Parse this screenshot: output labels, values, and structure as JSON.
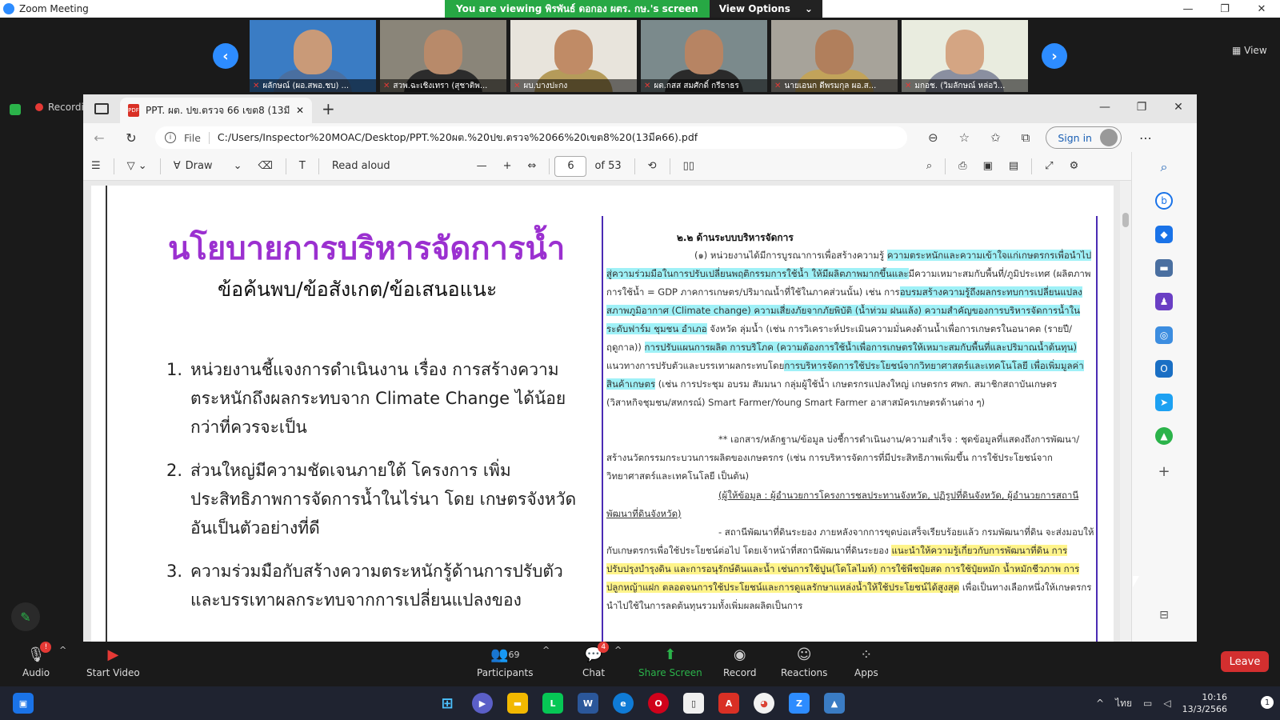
{
  "zoom": {
    "title": "Zoom Meeting",
    "share_banner": "You are viewing พิรพันธ์ ดอกอง ผตร. กษ.'s screen",
    "view_options": "View Options",
    "view_label": "View",
    "recording": "Recording",
    "participants": [
      {
        "name": "ผลักษณ์ (ผอ.สพอ.ชบ) ..."
      },
      {
        "name": "สวพ.ฉะเชิงเทรา (สุชาติพ..."
      },
      {
        "name": "ผบ.บางปะกง"
      },
      {
        "name": "ผต.กสส สมศักดิ์ กรีธาธร"
      },
      {
        "name": "นายเอนก ดีพรมกุล ผอ.ส..."
      },
      {
        "name": "มกอช. (วิมลักษณ์ หล่อวิ..."
      }
    ],
    "toolbar": {
      "audio": "Audio",
      "start_video": "Start Video",
      "participants": "Participants",
      "participants_count": "69",
      "chat": "Chat",
      "chat_badge": "4",
      "audio_badge": "!",
      "share_screen": "Share Screen",
      "record": "Record",
      "reactions": "Reactions",
      "apps": "Apps",
      "leave": "Leave"
    }
  },
  "edge": {
    "tab_title": "PPT. ผต. ปข.ตรวจ 66 เขต8 (13มีค6...",
    "file_label": "File",
    "url": "C:/Users/Inspector%20MOAC/Desktop/PPT.%20ผต.%20ปข.ตรวจ%2066%20เขต8%20(13มีค66).pdf",
    "sign_in": "Sign in",
    "draw": "Draw",
    "read_aloud": "Read aloud",
    "page_current": "6",
    "page_total": "of 53"
  },
  "slide": {
    "title": "นโยบายการบริหารจัดการน้ำ",
    "subtitle": "ข้อค้นพบ/ข้อสังเกต/ข้อเสนอแนะ",
    "items": [
      {
        "n": "1.",
        "text": "หน่วยงานชี้แจงการดำเนินงาน เรื่อง การสร้างความตระหนักถึงผลกระทบจาก Climate Change ได้น้อยกว่าที่ควรจะเป็น"
      },
      {
        "n": "2.",
        "text": "ส่วนใหญ่มีความชัดเจนภายใต้ โครงการ เพิ่มประสิทธิภาพการจัดการน้ำในไร่นา โดย เกษตรจังหวัด อันเป็นตัวอย่างที่ดี"
      },
      {
        "n": "3.",
        "text": "ความร่วมมือกับสร้างความตระหนักรู้ด้านการปรับตัวและบรรเทาผลกระทบจากการเปลี่ยนแปลงของ"
      }
    ]
  },
  "doc": {
    "heading": "๒.๒ ด้านระบบบริหารจัดการ",
    "p1a": "(๑) หน่วยงานได้มีการบูรณาการเพื่อสร้างความรู้ ",
    "p1b": "ความตระหนักและความเข้าใจแก่เกษตรกรเพื่อนำไปสู่ความร่วมมือในการปรับเปลี่ยนพฤติกรรมการใช้น้ำ ให้มีผลิตภาพมากขึ้นและ",
    "p1c": "มีความเหมาะสมกับพื้นที่/ภูมิประเทศ (ผลิตภาพการใช้น้ำ = GDP ภาคการเกษตร/ปริมาณน้ำที่ใช้ในภาคส่วนนั้น) เช่น การ",
    "p1d": "อบรมสร้างความรู้ถึงผลกระทบการเปลี่ยนแปลงสภาพภูมิอากาศ (Climate change) ความเสี่ยงภัยจากภัยพิบัติ (น้ำท่วม ฝนแล้ง) ความสำคัญของการบริหารจัดการน้ำในระดับฟาร์ม ชุมชน อำเภอ",
    "p1e": " จังหวัด ลุ่มน้ำ (เช่น การวิเคราะห์ประเมินความมั่นคงด้านน้ำเพื่อการเกษตรในอนาคต (รายปี/ฤดูกาล)) ",
    "p1f": "การปรับแผนการผลิต การบริโภค (ความต้องการใช้น้ำเพื่อการเกษตรให้เหมาะสมกับพื้นที่และปริมาณน้ำต้นทุน)",
    "p1g": " แนวทางการปรับตัวและบรรเทาผลกระทบโดย",
    "p1h": "การบริหารจัดการใช้ประโยชน์จากวิทยาศาสตร์และเทคโนโลยี เพื่อเพิ่มมูลค่าสินค้าเกษตร",
    "p1i": " (เช่น การประชุม อบรม สัมมนา กลุ่มผู้ใช้น้ำ เกษตรกรแปลงใหญ่ เกษตรกร ศพก. สมาชิกสถาบันเกษตร (วิสาหกิจชุมชน/สหกรณ์) Smart Farmer/Young Smart Farmer อาสาสมัครเกษตรด้านต่าง ๆ)",
    "p2": "** เอกสาร/หลักฐาน/ข้อมูล บ่งชี้การดำเนินงาน/ความสำเร็จ : ชุดข้อมูลที่แสดงถึงการพัฒนา/สร้างนวัตกรรมกระบวนการผลิตของเกษตรกร (เช่น การบริหารจัดการที่มีประสิทธิภาพเพิ่มขึ้น การใช้ประโยชน์จากวิทยาศาสตร์และเทคโนโลยี เป็นต้น)",
    "p3": "(ผู้ให้ข้อมูล : ผู้อำนวยการโครงการชลประทานจังหวัด, ปฏิรูปที่ดินจังหวัด, ผู้อำนวยการสถานีพัฒนาที่ดินจังหวัด)",
    "p4a": "- สถานีพัฒนาที่ดินระยอง ภายหลังจากการขุดบ่อเสร็จเรียบร้อยแล้ว กรมพัฒนาที่ดิน จะส่งมอบให้กับเกษตรกรเพื่อใช้ประโยชน์ต่อไป โดยเจ้าหน้าที่สถานีพัฒนาที่ดินระยอง ",
    "p4b": "แนะนำให้ความรู้เกี่ยวกับการพัฒนาที่ดิน การปรับปรุงบำรุงดิน และการอนุรักษ์ดินและน้ำ เช่นการใช้ปูน(โดโลไมท์) การใช้พืชปุ๋ยสด การใช้ปุ๋ยหมัก น้ำหมักชีวภาพ การปลูกหญ้าแฝก ตลอดจนการใช้ประโยชน์และการดูแลรักษาแหล่งน้ำให้ใช้ประโยชน์ได้สูงสุด",
    "p4c": " เพื่อเป็นทางเลือกหนึ่งให้เกษตรกรนำไปใช้ในการลดต้นทุนรวมทั้งเพิ่มผลผลิตเป็นการ"
  },
  "taskbar": {
    "lang": "ไทย",
    "time": "10:16",
    "date": "13/3/2566",
    "notif": "1"
  }
}
